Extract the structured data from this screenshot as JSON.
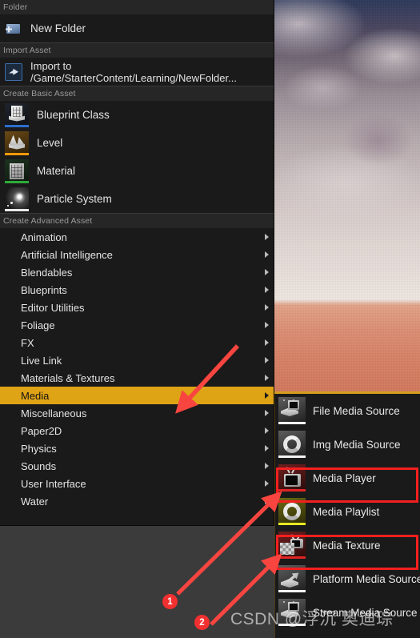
{
  "menu": {
    "sections": [
      {
        "label": "Folder",
        "type": "icon",
        "items": [
          {
            "label": "New Folder",
            "icon": "new-folder-icon"
          }
        ]
      },
      {
        "label": "Import Asset",
        "type": "icon",
        "items": [
          {
            "label": "Import to /Game/StarterContent/Learning/NewFolder...",
            "icon": "import-asset-icon"
          }
        ]
      },
      {
        "label": "Create Basic Asset",
        "type": "icon",
        "items": [
          {
            "label": "Blueprint Class",
            "icon": "blueprint-class-icon"
          },
          {
            "label": "Level",
            "icon": "level-icon"
          },
          {
            "label": "Material",
            "icon": "material-icon"
          },
          {
            "label": "Particle System",
            "icon": "particle-system-icon"
          }
        ]
      },
      {
        "label": "Create Advanced Asset",
        "type": "text",
        "items": [
          {
            "label": "Animation",
            "submenu": true,
            "highlighted": false
          },
          {
            "label": "Artificial Intelligence",
            "submenu": true,
            "highlighted": false
          },
          {
            "label": "Blendables",
            "submenu": true,
            "highlighted": false
          },
          {
            "label": "Blueprints",
            "submenu": true,
            "highlighted": false
          },
          {
            "label": "Editor Utilities",
            "submenu": true,
            "highlighted": false
          },
          {
            "label": "Foliage",
            "submenu": true,
            "highlighted": false
          },
          {
            "label": "FX",
            "submenu": true,
            "highlighted": false
          },
          {
            "label": "Live Link",
            "submenu": true,
            "highlighted": false
          },
          {
            "label": "Materials & Textures",
            "submenu": true,
            "highlighted": false
          },
          {
            "label": "Media",
            "submenu": true,
            "highlighted": true
          },
          {
            "label": "Miscellaneous",
            "submenu": true,
            "highlighted": false
          },
          {
            "label": "Paper2D",
            "submenu": true,
            "highlighted": false
          },
          {
            "label": "Physics",
            "submenu": true,
            "highlighted": false
          },
          {
            "label": "Sounds",
            "submenu": true,
            "highlighted": false
          },
          {
            "label": "User Interface",
            "submenu": true,
            "highlighted": false
          },
          {
            "label": "Water",
            "submenu": true,
            "highlighted": false
          }
        ]
      }
    ]
  },
  "submenu": {
    "items": [
      {
        "label": "File Media Source",
        "icon": "file-media-source-icon",
        "highlighted": false
      },
      {
        "label": "Img Media Source",
        "icon": "img-media-source-icon",
        "highlighted": false
      },
      {
        "label": "Media Player",
        "icon": "media-player-icon",
        "highlighted": true
      },
      {
        "label": "Media Playlist",
        "icon": "media-playlist-icon",
        "highlighted": false
      },
      {
        "label": "Media Texture",
        "icon": "media-texture-icon",
        "highlighted": true
      },
      {
        "label": "Platform Media Source",
        "icon": "platform-media-source-icon",
        "highlighted": false
      },
      {
        "label": "Stream Media Source",
        "icon": "stream-media-source-icon",
        "highlighted": false
      }
    ]
  },
  "annotations": {
    "badges": [
      {
        "number": "1"
      },
      {
        "number": "2"
      }
    ],
    "arrow_color": "#f23030",
    "highlight_box_color": "#f41f1f"
  },
  "watermark": {
    "text": "CSDN @浮沉 奥迪琮"
  },
  "colors": {
    "menu_background": "#1a1a1a",
    "section_header_background": "#262626",
    "highlight_amber": "#dfa316",
    "text_primary": "#e3e3e3",
    "text_muted": "#9a9a9a",
    "page_background": "#3b3b3b"
  }
}
